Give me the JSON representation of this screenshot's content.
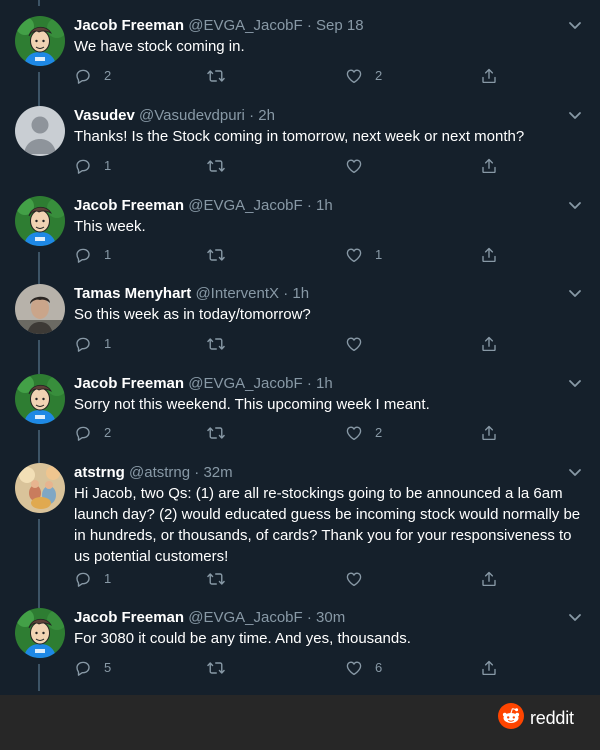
{
  "tweets": [
    {
      "name": "Jacob Freeman",
      "handle": "@EVGA_JacobF",
      "separator": "·",
      "time": "Sep 18",
      "text": "We have stock coming in.",
      "avatar": "cartoon-avatar-icon",
      "replies": "2",
      "retweets": "",
      "likes": "2"
    },
    {
      "name": "Vasudev",
      "handle": "@Vasudevdpuri",
      "separator": "·",
      "time": "2h",
      "text": "Thanks! Is the Stock coming in tomorrow, next week or next month?",
      "avatar": "default-avatar-icon",
      "replies": "1",
      "retweets": "",
      "likes": ""
    },
    {
      "name": "Jacob Freeman",
      "handle": "@EVGA_JacobF",
      "separator": "·",
      "time": "1h",
      "text": "This week.",
      "avatar": "cartoon-avatar-icon",
      "replies": "1",
      "retweets": "",
      "likes": "1"
    },
    {
      "name": "Tamas Menyhart",
      "handle": "@InterventX",
      "separator": "·",
      "time": "1h",
      "text": "So this week as in today/tomorrow?",
      "avatar": "photo-avatar-icon",
      "replies": "1",
      "retweets": "",
      "likes": ""
    },
    {
      "name": "Jacob Freeman",
      "handle": "@EVGA_JacobF",
      "separator": "·",
      "time": "1h",
      "text": "Sorry not this weekend. This upcoming week I meant.",
      "avatar": "cartoon-avatar-icon",
      "replies": "2",
      "retweets": "",
      "likes": "2"
    },
    {
      "name": "atstrng",
      "handle": "@atstrng",
      "separator": "·",
      "time": "32m",
      "text": "Hi Jacob, two Qs: (1) are all re-stockings going to be announced a la 6am launch day? (2) would educated guess be incoming stock would normally be in hundreds, or thousands, of cards? Thank you for your responsiveness to us potential customers!",
      "avatar": "photo-avatar-icon",
      "replies": "1",
      "retweets": "",
      "likes": ""
    },
    {
      "name": "Jacob Freeman",
      "handle": "@EVGA_JacobF",
      "separator": "·",
      "time": "30m",
      "text": "For 3080 it could be any time. And yes, thousands.",
      "avatar": "cartoon-avatar-icon",
      "replies": "5",
      "retweets": "",
      "likes": "6"
    }
  ],
  "footer": {
    "brand": "reddit",
    "logo": "reddit-logo-icon"
  },
  "colors": {
    "background": "#15202b",
    "muted": "#8899a6",
    "thread_line": "#3d5466",
    "footer_bg": "#272727",
    "reddit_orange": "#ff4500"
  }
}
